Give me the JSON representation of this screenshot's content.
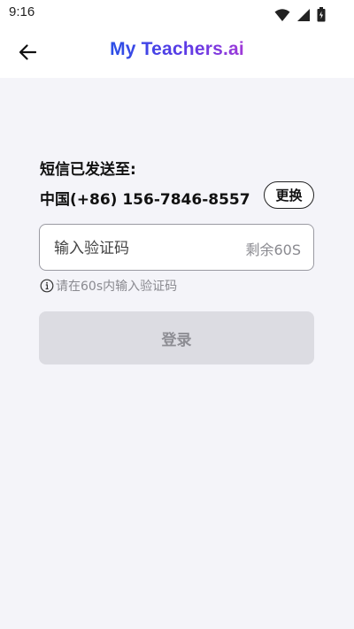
{
  "status_bar": {
    "time": "9:16",
    "icons": [
      "wifi-icon",
      "signal-icon",
      "battery-icon"
    ]
  },
  "header": {
    "back_icon": "arrow-left-icon",
    "brand": "My Teachers.ai"
  },
  "verification": {
    "sent_label": "短信已发送至:",
    "phone": "中国(+86) 156-7846-8557",
    "change_label": "更换",
    "input_placeholder": "输入验证码",
    "countdown": "剩余60S",
    "hint_icon": "info-icon",
    "hint": "请在60s内输入验证码",
    "login_label": "登录"
  },
  "colors": {
    "page_background": "#f4f4f9",
    "brand_gradient_start": "#2a4fe6",
    "brand_gradient_end": "#a03ad8",
    "login_disabled": "#dcdce2"
  }
}
